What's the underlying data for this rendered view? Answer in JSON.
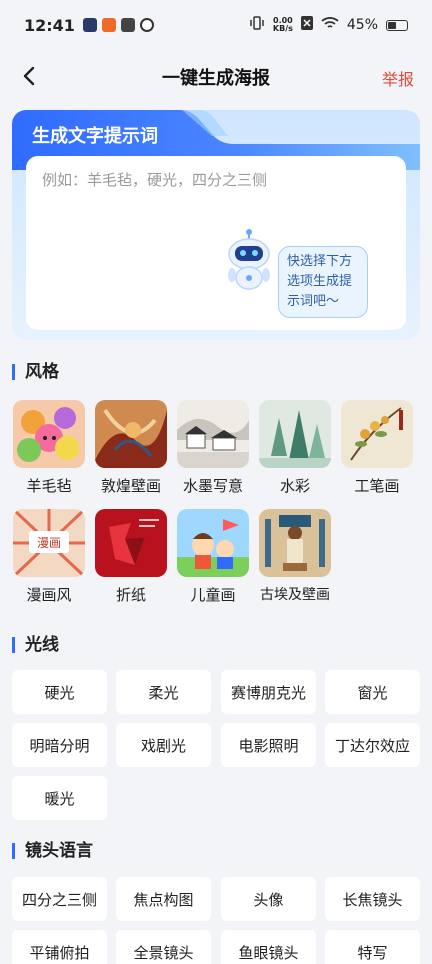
{
  "status": {
    "time": "12:41",
    "net_speed_top": "0.00",
    "net_speed_unit": "KB/s",
    "battery": "45%"
  },
  "nav": {
    "title": "一键生成海报",
    "report": "举报"
  },
  "prompt": {
    "title": "生成文字提示词",
    "placeholder": "例如：羊毛毡，硬光，四分之三侧",
    "bubble": "快选择下方选项生成提示词吧～"
  },
  "style": {
    "title": "风格",
    "items": [
      {
        "label": "羊毛毡",
        "icon": "wool-felt-thumbnail"
      },
      {
        "label": "敦煌壁画",
        "icon": "dunhuang-thumbnail"
      },
      {
        "label": "水墨写意",
        "icon": "ink-wash-thumbnail"
      },
      {
        "label": "水彩",
        "icon": "watercolor-thumbnail"
      },
      {
        "label": "工笔画",
        "icon": "gongbi-thumbnail"
      },
      {
        "label": "漫画风",
        "icon": "comic-thumbnail"
      },
      {
        "label": "折纸",
        "icon": "origami-thumbnail"
      },
      {
        "label": "儿童画",
        "icon": "children-drawing-thumbnail"
      },
      {
        "label": "古埃及壁画",
        "icon": "egyptian-mural-thumbnail"
      }
    ]
  },
  "light": {
    "title": "光线",
    "items": [
      "硬光",
      "柔光",
      "赛博朋克光",
      "窗光",
      "明暗分明",
      "戏剧光",
      "电影照明",
      "丁达尔效应",
      "暖光"
    ]
  },
  "lens": {
    "title": "镜头语言",
    "items": [
      "四分之三侧",
      "焦点构图",
      "头像",
      "长焦镜头",
      "平铺俯拍",
      "全景镜头",
      "鱼眼镜头",
      "特写"
    ]
  },
  "colors": {
    "accent": "#2f6bff",
    "report": "#e04a3b"
  }
}
